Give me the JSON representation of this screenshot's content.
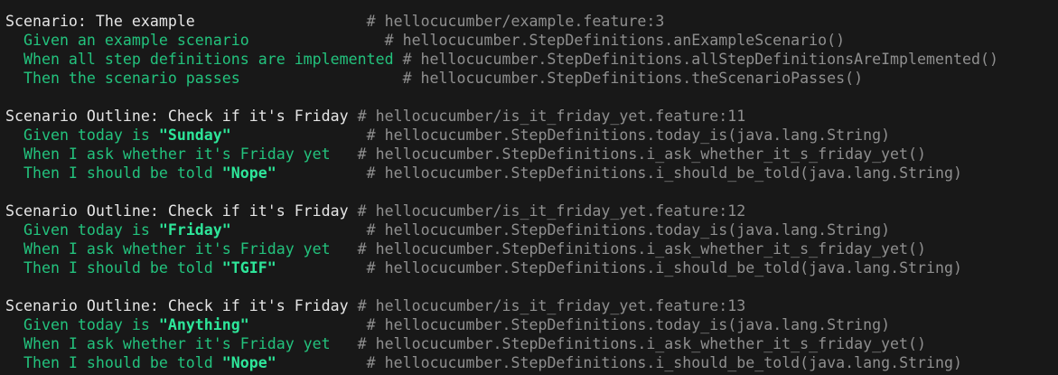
{
  "lines": [
    [
      {
        "t": "Scenario: The example                   ",
        "c": "title"
      },
      {
        "t": "# hellocucumber/example.feature:3",
        "c": "comment"
      }
    ],
    [
      {
        "t": "  Given an example scenario               ",
        "c": "step"
      },
      {
        "t": "# hellocucumber.StepDefinitions.anExampleScenario()",
        "c": "comment"
      }
    ],
    [
      {
        "t": "  When all step definitions are implemented ",
        "c": "step"
      },
      {
        "t": "# hellocucumber.StepDefinitions.allStepDefinitionsAreImplemented()",
        "c": "comment"
      }
    ],
    [
      {
        "t": "  Then the scenario passes                  ",
        "c": "step"
      },
      {
        "t": "# hellocucumber.StepDefinitions.theScenarioPasses()",
        "c": "comment"
      }
    ],
    [],
    [
      {
        "t": "Scenario Outline: Check if it's Friday ",
        "c": "title"
      },
      {
        "t": "# hellocucumber/is_it_friday_yet.feature:11",
        "c": "comment"
      }
    ],
    [
      {
        "t": "  Given today is ",
        "c": "step"
      },
      {
        "t": "\"Sunday\"",
        "c": "arg"
      },
      {
        "t": "               ",
        "c": "step"
      },
      {
        "t": "# hellocucumber.StepDefinitions.today_is(java.lang.String)",
        "c": "comment"
      }
    ],
    [
      {
        "t": "  When I ask whether it's Friday yet   ",
        "c": "step"
      },
      {
        "t": "# hellocucumber.StepDefinitions.i_ask_whether_it_s_friday_yet()",
        "c": "comment"
      }
    ],
    [
      {
        "t": "  Then I should be told ",
        "c": "step"
      },
      {
        "t": "\"Nope\"",
        "c": "arg"
      },
      {
        "t": "          ",
        "c": "step"
      },
      {
        "t": "# hellocucumber.StepDefinitions.i_should_be_told(java.lang.String)",
        "c": "comment"
      }
    ],
    [],
    [
      {
        "t": "Scenario Outline: Check if it's Friday ",
        "c": "title"
      },
      {
        "t": "# hellocucumber/is_it_friday_yet.feature:12",
        "c": "comment"
      }
    ],
    [
      {
        "t": "  Given today is ",
        "c": "step"
      },
      {
        "t": "\"Friday\"",
        "c": "arg"
      },
      {
        "t": "               ",
        "c": "step"
      },
      {
        "t": "# hellocucumber.StepDefinitions.today_is(java.lang.String)",
        "c": "comment"
      }
    ],
    [
      {
        "t": "  When I ask whether it's Friday yet   ",
        "c": "step"
      },
      {
        "t": "# hellocucumber.StepDefinitions.i_ask_whether_it_s_friday_yet()",
        "c": "comment"
      }
    ],
    [
      {
        "t": "  Then I should be told ",
        "c": "step"
      },
      {
        "t": "\"TGIF\"",
        "c": "arg"
      },
      {
        "t": "          ",
        "c": "step"
      },
      {
        "t": "# hellocucumber.StepDefinitions.i_should_be_told(java.lang.String)",
        "c": "comment"
      }
    ],
    [],
    [
      {
        "t": "Scenario Outline: Check if it's Friday ",
        "c": "title"
      },
      {
        "t": "# hellocucumber/is_it_friday_yet.feature:13",
        "c": "comment"
      }
    ],
    [
      {
        "t": "  Given today is ",
        "c": "step"
      },
      {
        "t": "\"Anything\"",
        "c": "arg"
      },
      {
        "t": "             ",
        "c": "step"
      },
      {
        "t": "# hellocucumber.StepDefinitions.today_is(java.lang.String)",
        "c": "comment"
      }
    ],
    [
      {
        "t": "  When I ask whether it's Friday yet   ",
        "c": "step"
      },
      {
        "t": "# hellocucumber.StepDefinitions.i_ask_whether_it_s_friday_yet()",
        "c": "comment"
      }
    ],
    [
      {
        "t": "  Then I should be told ",
        "c": "step"
      },
      {
        "t": "\"Nope\"",
        "c": "arg"
      },
      {
        "t": "          ",
        "c": "step"
      },
      {
        "t": "# hellocucumber.StepDefinitions.i_should_be_told(java.lang.String)",
        "c": "comment"
      }
    ]
  ],
  "colors": {
    "background": "#181818",
    "step": "#23c27d",
    "argument": "#2ee69a",
    "comment": "#8f8f8f",
    "text": "#e5e5e5"
  }
}
